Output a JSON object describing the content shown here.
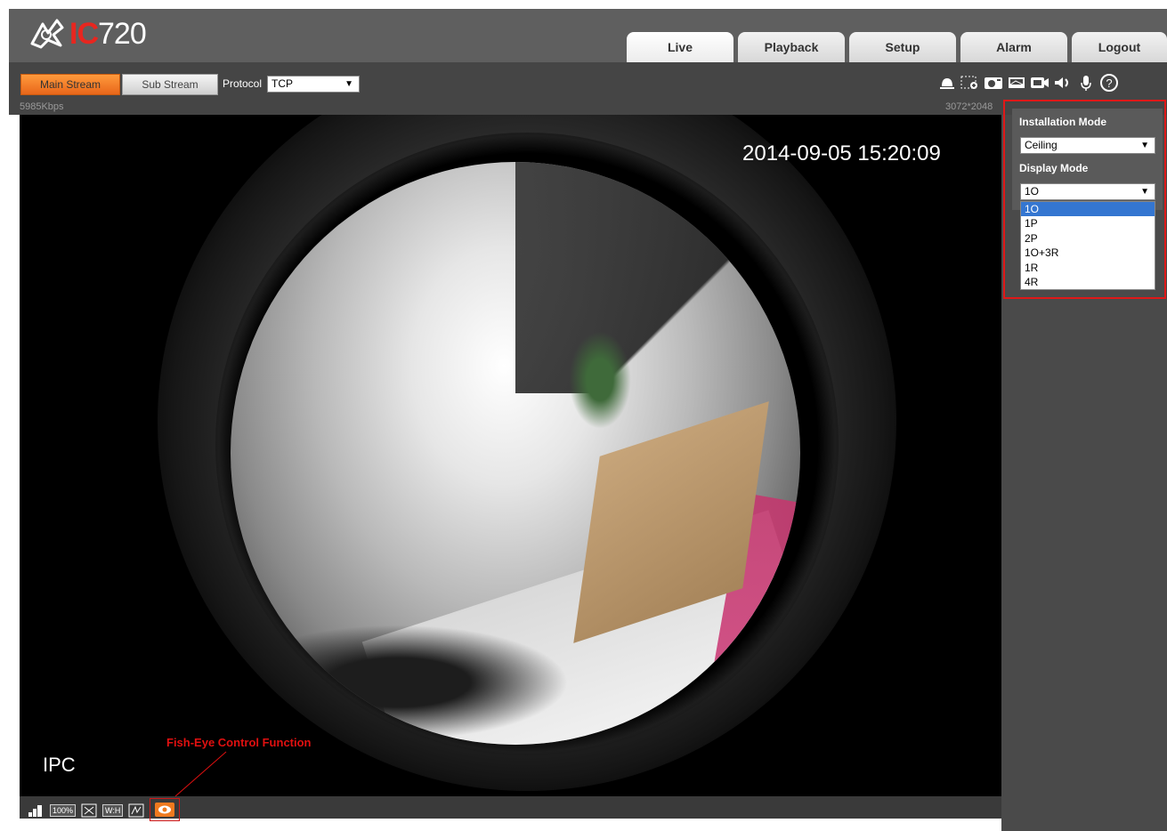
{
  "brand": {
    "logo_ic": "IC",
    "logo_num": "720"
  },
  "tabs": [
    {
      "label": "Live"
    },
    {
      "label": "Playback"
    },
    {
      "label": "Setup"
    },
    {
      "label": "Alarm"
    },
    {
      "label": "Logout"
    }
  ],
  "toolbar": {
    "main_stream": "Main Stream",
    "sub_stream": "Sub Stream",
    "protocol_label": "Protocol",
    "protocol_value": "TCP",
    "bitrate": "5985Kbps",
    "resolution": "3072*2048",
    "icons": [
      "alarm-bell-icon",
      "zoom-region-icon",
      "snapshot-icon",
      "triple-snapshot-icon",
      "record-icon",
      "speaker-icon",
      "microphone-icon",
      "help-icon"
    ]
  },
  "video": {
    "timestamp": "2014-09-05 15:20:09",
    "channel_label": "IPC",
    "fisheye_note": "Fish-Eye Control Function"
  },
  "bottom_bar": {
    "icons": [
      "fluency-icon",
      "original-size-icon",
      "fullscreen-icon",
      "wh-ratio-icon",
      "rules-icon",
      "fisheye-icon"
    ],
    "original_size_label": "100%",
    "wh_label": "W:H"
  },
  "fisheye_panel": {
    "installation_mode_label": "Installation Mode",
    "installation_mode_value": "Ceiling",
    "display_mode_label": "Display Mode",
    "display_mode_value": "1O",
    "display_mode_options": [
      "1O",
      "1P",
      "2P",
      "1O+3R",
      "1R",
      "4R"
    ],
    "selected_option": "1O"
  },
  "colors": {
    "accent_orange": "#e8661a",
    "highlight_red": "#e01818",
    "selection_blue": "#3476d1",
    "header_gray": "#5f5f5f"
  }
}
